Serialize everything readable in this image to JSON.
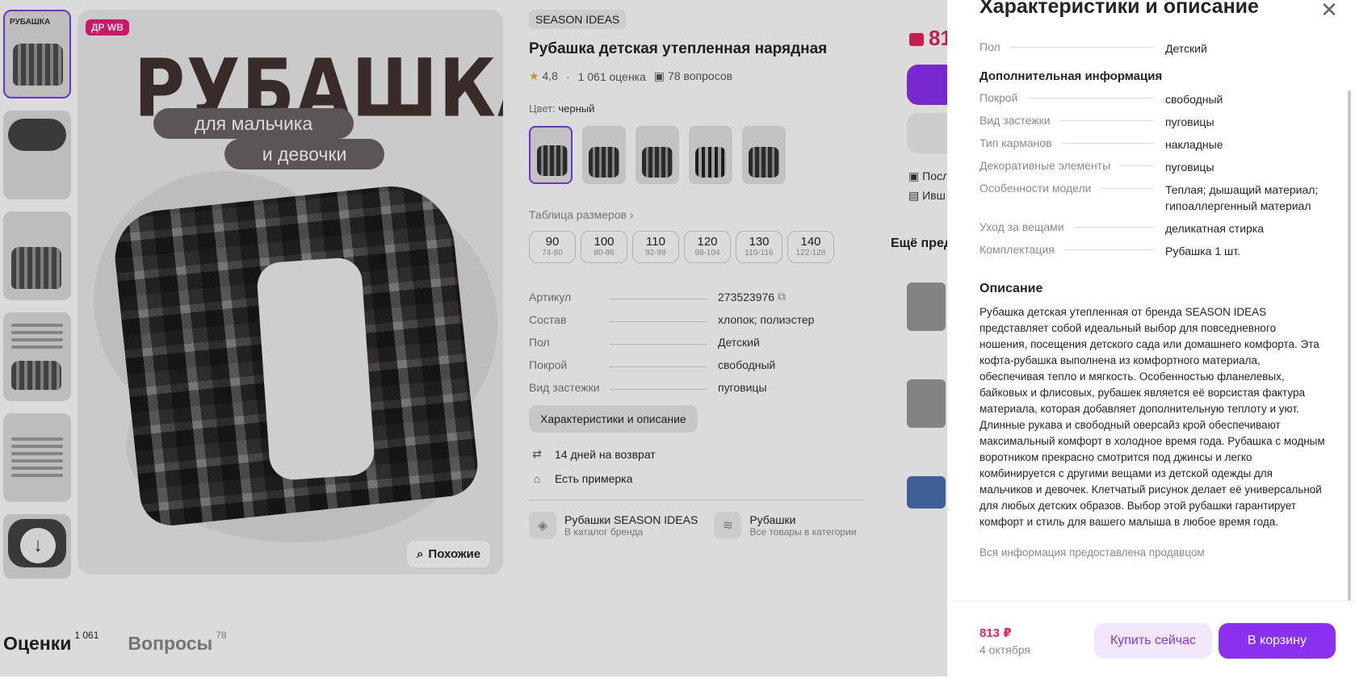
{
  "gallery": {
    "badge": "ДР WB",
    "big_title": "РУБАШКА",
    "pill_1": "для мальчика",
    "pill_2": "и девочки",
    "similar_label": "Похожие",
    "thumb_title": "РУБАШКА"
  },
  "product": {
    "brand": "SEASON IDEAS",
    "title": "Рубашка детская утепленная нарядная",
    "rating": "4,8",
    "reviews": "1 061 оценка",
    "questions": "78 вопросов",
    "color_label": "Цвет:",
    "color_value": "черный",
    "size_table_link": "Таблица размеров",
    "sizes": [
      {
        "n": "90",
        "r": "74-80"
      },
      {
        "n": "100",
        "r": "80-86"
      },
      {
        "n": "110",
        "r": "92-98"
      },
      {
        "n": "120",
        "r": "98-104"
      },
      {
        "n": "130",
        "r": "110-116"
      },
      {
        "n": "140",
        "r": "122-128"
      }
    ],
    "specs": [
      {
        "k": "Артикул",
        "v": "273523976"
      },
      {
        "k": "Состав",
        "v": "хлопок; полиэстер"
      },
      {
        "k": "Пол",
        "v": "Детский"
      },
      {
        "k": "Покрой",
        "v": "свободный"
      },
      {
        "k": "Вид застежки",
        "v": "пуговицы"
      }
    ],
    "char_button": "Характеристики и описание",
    "return_text": "14 дней на возврат",
    "fitting_text": "Есть примерка",
    "brand_link_title": "Рубашки SEASON IDEAS",
    "brand_link_sub": "В каталог бренда",
    "cat_link_title": "Рубашки",
    "cat_link_sub": "Все товары в категории"
  },
  "side": {
    "price_fragment": "81",
    "line1": "Посл",
    "line2": "Ивш",
    "more_title": "Ещё пред"
  },
  "tabs": {
    "reviews_label": "Оценки",
    "reviews_count": "1 061",
    "questions_label": "Вопросы",
    "questions_count": "78"
  },
  "panel": {
    "title": "Характеристики и описание",
    "top_row": {
      "k": "Пол",
      "v": "Детский"
    },
    "additional_title": "Дополнительная информация",
    "rows": [
      {
        "k": "Покрой",
        "v": "свободный"
      },
      {
        "k": "Вид застежки",
        "v": "пуговицы"
      },
      {
        "k": "Тип карманов",
        "v": "накладные"
      },
      {
        "k": "Декоративные элементы",
        "v": "пуговицы"
      },
      {
        "k": "Особенности модели",
        "v": "Теплая; дышащий материал; гипоаллергенный материал"
      },
      {
        "k": "Уход за вещами",
        "v": "деликатная стирка"
      },
      {
        "k": "Комплектация",
        "v": "Рубашка 1 шт."
      }
    ],
    "description_title": "Описание",
    "description": "Рубашка детская утепленная от бренда SEASON IDEAS представляет собой идеальный выбор для повседневного ношения, посещения детского сада или домашнего комфорта. Эта кофта-рубашка выполнена из комфортного материала, обеспечивая тепло и мягкость. Особенностью фланелевых, байковых и флисовых, рубашек является её ворсистая фактура материала, которая добавляет дополнительную теплоту и уют. Длинные рукава и свободный оверсайз крой обеспечивают максимальный комфорт в холодное время года. Рубашка с модным воротником прекрасно смотрится под джинсы и легко комбинируется с другими вещами из детской одежды для мальчиков и девочек. Клетчатый рисунок делает её универсальной для любых детских образов. Выбор этой рубашки гарантирует комфорт и стиль для вашего малыша в любое время года.",
    "seller_note": "Вся информация предоставлена продавцом",
    "price": "813 ₽",
    "date": "4 октября",
    "buy_now": "Купить сейчас",
    "to_cart": "В корзину"
  },
  "colors": {
    "accent": "#8b2ff0",
    "price": "#e5245d",
    "badge": "#ea1c7a"
  }
}
